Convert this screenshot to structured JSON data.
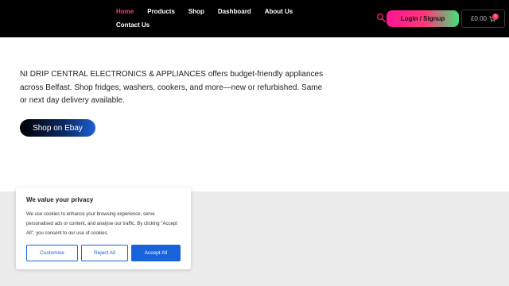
{
  "nav": {
    "items": [
      {
        "label": "Home",
        "active": true
      },
      {
        "label": "Products",
        "active": false
      },
      {
        "label": "Shop",
        "active": false
      },
      {
        "label": "Dashboard",
        "active": false
      },
      {
        "label": "About Us",
        "active": false
      },
      {
        "label": "Contact Us",
        "active": false
      }
    ],
    "active_color": "#ff2f8a"
  },
  "header": {
    "search_icon": "search-icon",
    "login_label": "Login / Signup",
    "cart": {
      "amount": "£0.00",
      "badge_count": "0",
      "icon": "cart-icon"
    }
  },
  "hero": {
    "text": "NI DRIP CENTRAL ELECTRONICS & APPLIANCES offers budget-friendly appliances across Belfast. Shop fridges, washers, cookers, and more—new or refurbished. Same or next day delivery available.",
    "button_label": "Shop on Ebay"
  },
  "cookie": {
    "title": "We value your privacy",
    "body": "We use cookies to enhance your browsing experience, serve personalised ads or content, and analyse our traffic. By clicking \"Accept All\", you consent to our use of cookies.",
    "customise_label": "Customise",
    "reject_label": "Reject All",
    "accept_label": "Accept All",
    "accent_color": "#1863dc"
  }
}
